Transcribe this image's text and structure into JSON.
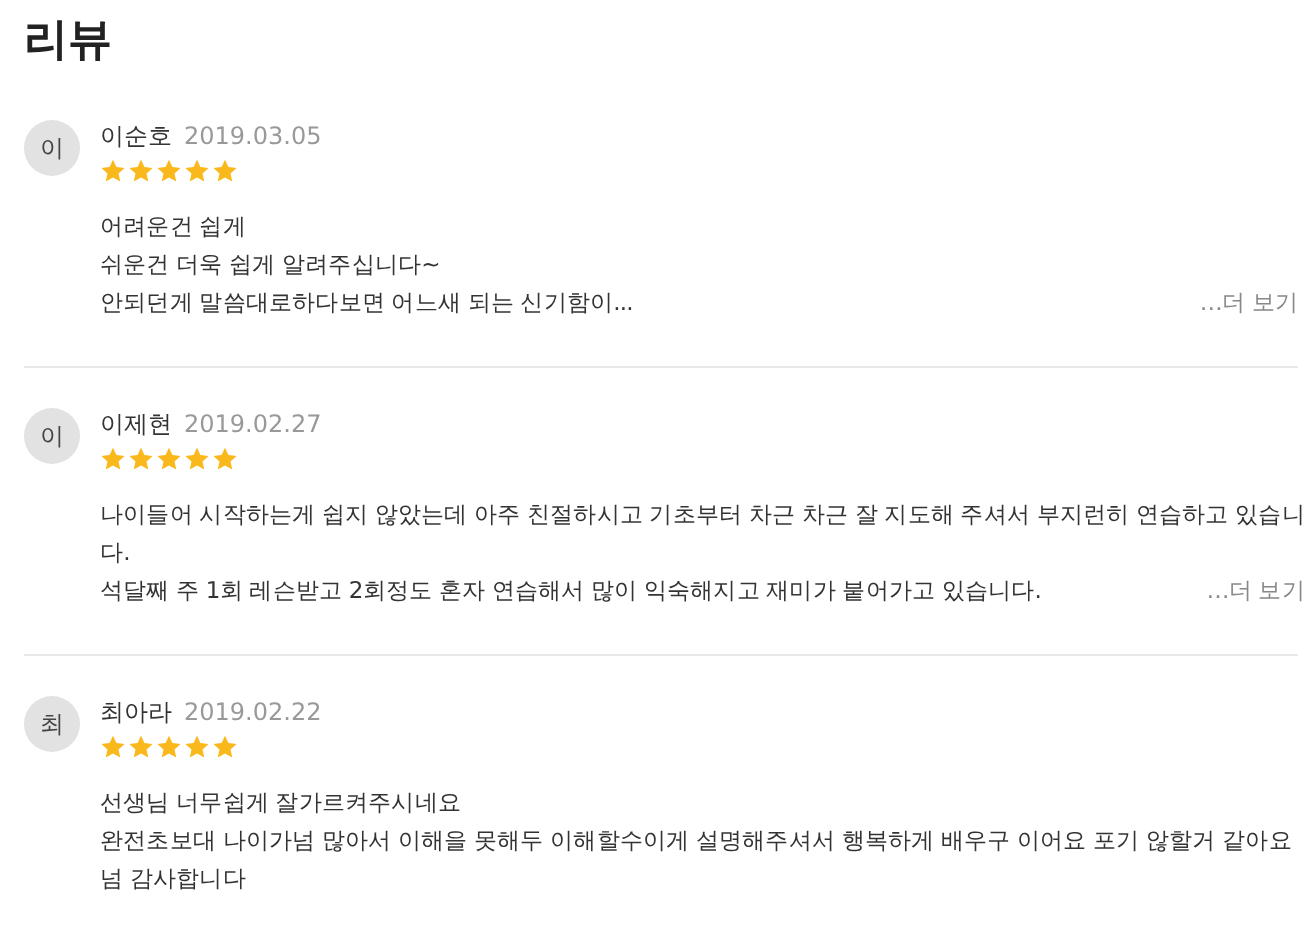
{
  "title": "리뷰",
  "reviews": [
    {
      "initial": "이",
      "name": "이순호",
      "date": "2019.03.05",
      "stars": 5,
      "lines": [
        "어려운건 쉽게",
        "쉬운건 더욱 쉽게 알려주십니다~",
        "안되던게 말씀대로하다보면 어느새 되는 신기함이..."
      ],
      "more": "…더 보기"
    },
    {
      "initial": "이",
      "name": "이제현",
      "date": "2019.02.27",
      "stars": 5,
      "lines": [
        "나이들어 시작하는게 쉽지 않았는데 아주 친절하시고 기초부터 차근 차근 잘 지도해 주셔서 부지런히 연습하고 있습니",
        "다.",
        "석달째 주 1회 레슨받고 2회정도 혼자 연습해서 많이 익숙해지고 재미가 붙어가고 있습니다."
      ],
      "more": "…더 보기"
    },
    {
      "initial": "최",
      "name": "최아라",
      "date": "2019.02.22",
      "stars": 5,
      "lines": [
        "선생님 너무쉽게 잘가르켜주시네요",
        "완전초보대 나이가넘 많아서 이해을 못해두 이해할수이게 설명해주셔서 행복하게 배우구 이어요 포기 않할거 같아요",
        "넘 감사합니다"
      ]
    }
  ]
}
